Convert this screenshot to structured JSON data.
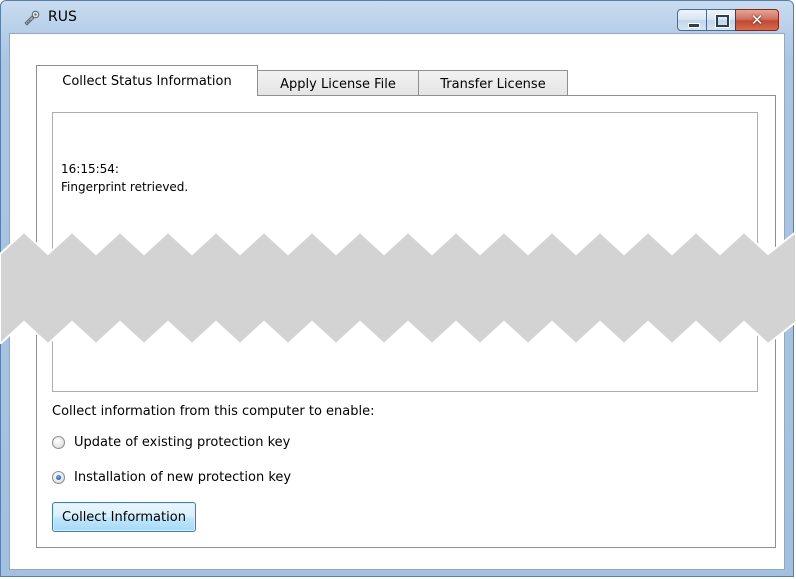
{
  "window": {
    "title": "RUS",
    "icon": "rus-app-icon",
    "caption_buttons": [
      "minimize",
      "maximize",
      "close"
    ]
  },
  "tabs": [
    {
      "label": "Collect Status Information",
      "active": true
    },
    {
      "label": "Apply License File",
      "active": false
    },
    {
      "label": "Transfer License",
      "active": false
    }
  ],
  "log": {
    "lines": [
      "16:15:54:",
      "Fingerprint retrieved."
    ]
  },
  "collect": {
    "instruction": "Collect information from this computer to enable:",
    "options": [
      {
        "label": "Update of existing protection key",
        "checked": false
      },
      {
        "label": "Installation of new protection key",
        "checked": true
      }
    ],
    "button_label": "Collect Information"
  },
  "colors": {
    "window_frame": "#a3c0e0",
    "close_button": "#c04a33",
    "button_accent": "#3c7fb1",
    "radio_checked": "#1c63c6"
  }
}
